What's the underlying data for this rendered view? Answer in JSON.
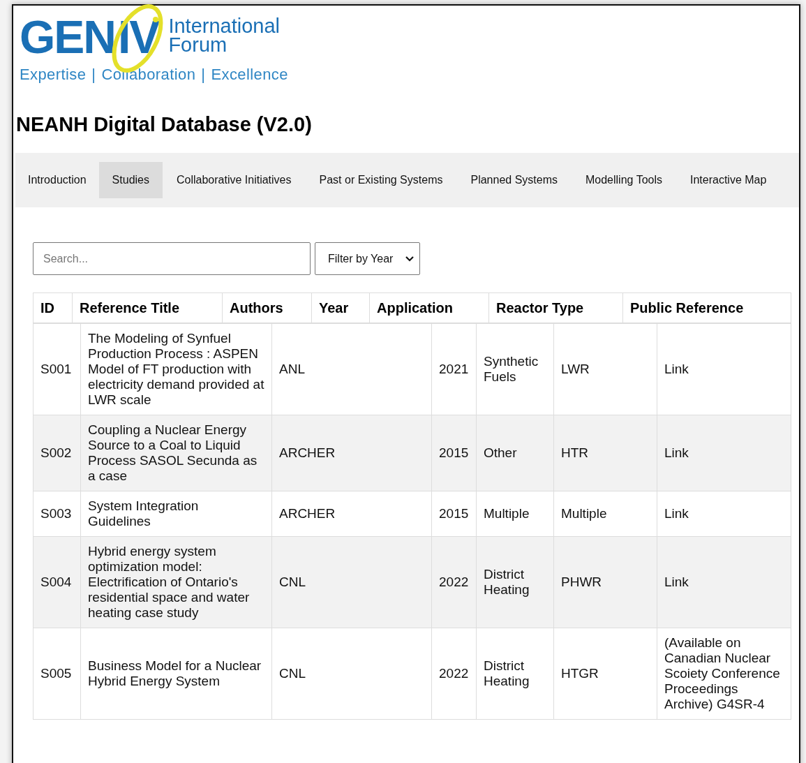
{
  "logo": {
    "mark_left": "GEN",
    "mark_right": "IV",
    "name_line_1": "International",
    "name_line_2": "Forum",
    "tagline": [
      "Expertise",
      "Collaboration",
      "Excellence"
    ],
    "separator": "|"
  },
  "page_title": "NEANH Digital Database (V2.0)",
  "tabs": [
    {
      "label": "Introduction",
      "selected": false
    },
    {
      "label": "Studies",
      "selected": true
    },
    {
      "label": "Collaborative Initiatives",
      "selected": false
    },
    {
      "label": "Past or Existing Systems",
      "selected": false
    },
    {
      "label": "Planned Systems",
      "selected": false
    },
    {
      "label": "Modelling Tools",
      "selected": false
    },
    {
      "label": "Interactive Map",
      "selected": false
    }
  ],
  "search": {
    "placeholder": "Search..."
  },
  "year_filter": {
    "label": "Filter by Year"
  },
  "table": {
    "columns": [
      "ID",
      "Reference Title",
      "Authors",
      "Year",
      "Application",
      "Reactor Type",
      "Public Reference"
    ],
    "rows": [
      {
        "id": "S001",
        "title": "The Modeling of Synfuel Production Process : ASPEN Model of FT production with electricity demand provided at LWR scale",
        "authors": "ANL",
        "year": "2021",
        "application": "Synthetic Fuels",
        "reactor_type": "LWR",
        "public_reference": {
          "kind": "link",
          "text": "Link"
        }
      },
      {
        "id": "S002",
        "title": "Coupling a Nuclear Energy Source to a Coal to Liquid Process SASOL Secunda as a case",
        "authors": "ARCHER",
        "year": "2015",
        "application": "Other",
        "reactor_type": "HTR",
        "public_reference": {
          "kind": "link",
          "text": "Link"
        }
      },
      {
        "id": "S003",
        "title": "System Integration Guidelines",
        "authors": "ARCHER",
        "year": "2015",
        "application": "Multiple",
        "reactor_type": "Multiple",
        "public_reference": {
          "kind": "link",
          "text": "Link"
        }
      },
      {
        "id": "S004",
        "title": "Hybrid energy system optimization model: Electrification of Ontario's residential space and water heating case study",
        "authors": "CNL",
        "year": "2022",
        "application": "District Heating",
        "reactor_type": "PHWR",
        "public_reference": {
          "kind": "link",
          "text": "Link"
        }
      },
      {
        "id": "S005",
        "title": "Business Model for a Nuclear Hybrid Energy System",
        "authors": "CNL",
        "year": "2022",
        "application": "District Heating",
        "reactor_type": "HTGR",
        "public_reference": {
          "kind": "text",
          "text": "(Available on Canadian Nuclear Scoiety Conference Proceedings Archive) G4SR-4"
        }
      }
    ]
  }
}
